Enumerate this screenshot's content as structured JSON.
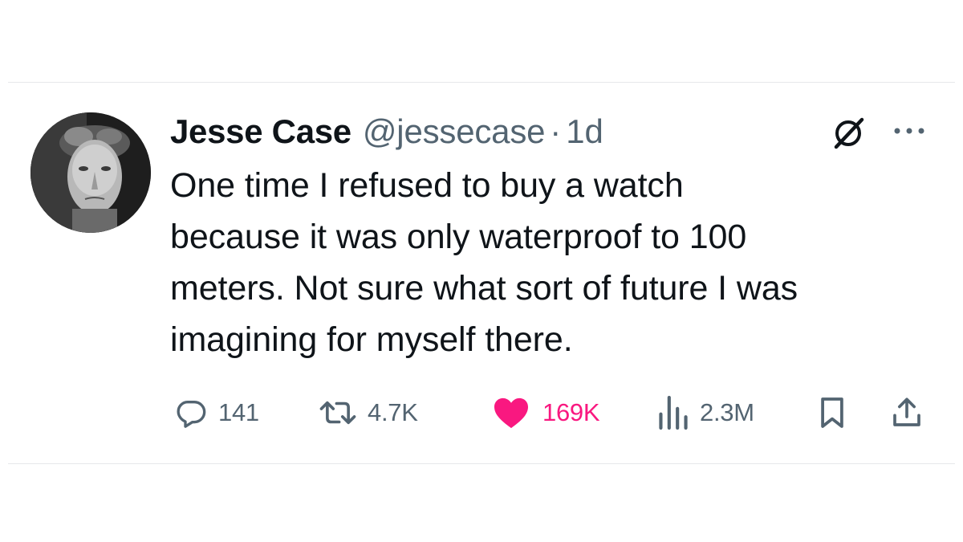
{
  "tweet": {
    "author": {
      "display_name": "Jesse Case",
      "handle": "@jessecase"
    },
    "separator": "·",
    "timestamp": "1d",
    "text": "One time I refused to buy a watch\nbecause it was only waterproof to 100\nmeters. Not sure what sort of future I was\nimagining for myself there.",
    "metrics": {
      "replies": "141",
      "retweets": "4.7K",
      "likes": "169K",
      "views": "2.3M"
    },
    "liked": true
  },
  "colors": {
    "text_primary": "#0f1419",
    "text_secondary": "#536471",
    "like_pink": "#f91880",
    "divider": "#e6e8ea"
  },
  "icons": {
    "header": [
      "grok-icon",
      "more-icon"
    ],
    "actions": [
      "reply-icon",
      "retweet-icon",
      "like-icon",
      "views-icon",
      "bookmark-icon",
      "share-icon"
    ]
  }
}
